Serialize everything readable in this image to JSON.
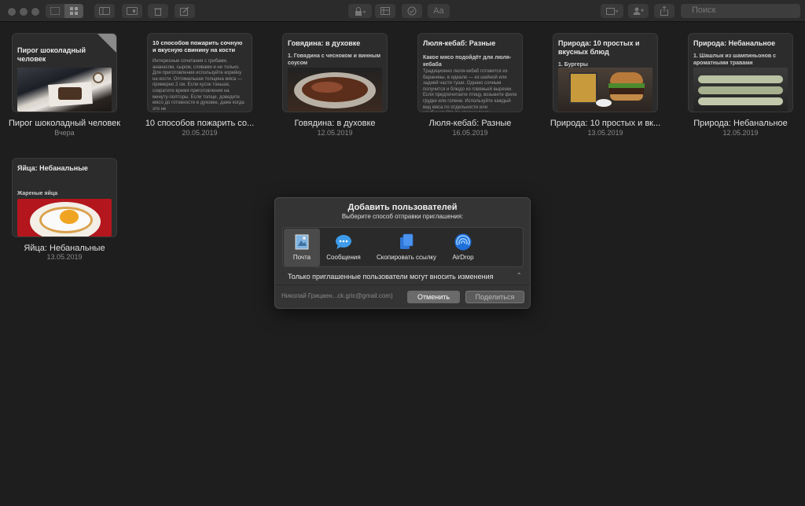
{
  "toolbar": {
    "search_placeholder": "Поиск",
    "font_button": "Aa"
  },
  "notes": [
    {
      "title": "Пирог шоколадный человек",
      "caption": "Пирог шоколадный человек",
      "date": "Вчера",
      "pinned": true,
      "image": "food-photo-cake"
    },
    {
      "title": "10 способов пожарить сочную и вкусную свинину на кости",
      "caption": "10 способов пожарить со...",
      "date": "20.05.2019",
      "body": "Интересные сочетания с грибами, ананасом, сыром, сливами и не только. Для приготовления используйте корейку на кости. Оптимальная толщина мяса — примерно 2 см. Если кусок тоньше, сократите время приготовления на минуту-полторы. Если толще, доведите мясо до готовности в духовке, даже когда это не"
    },
    {
      "title": "Говядина: в духовке",
      "subtitle": "1. Говядина с чесноком и винным соусом",
      "caption": "Говядина: в духовке",
      "date": "12.05.2019",
      "image": "food-photo-beef"
    },
    {
      "title": "Люля-кебаб: Разные",
      "subtitle": "Какое мясо подойдёт для люля-кебаба",
      "caption": "Люля-кебаб: Разные",
      "date": "16.05.2019",
      "body": "Традиционно люля-кебаб готовится из баранины, в идеале — из шейной или задней части туши. Однако сочным получится и блюдо из говяжьей вырезки. Если предпочитаете птицу, возьмите филе грудки или голени. Используйте каждый вид мяса по отдельности или комбинируйте по своему вкусу."
    },
    {
      "title": "Природа: 10 простых и вкусных блюд",
      "subtitle": "1. Бургеры",
      "caption": "Природа: 10 простых и вк...",
      "date": "13.05.2019",
      "image": "food-photo-burger"
    },
    {
      "title": "Природа: Небанальное",
      "subtitle": "1. Шашлык из шампиньонов с ароматными травами",
      "caption": "Природа: Небанальное",
      "date": "12.05.2019",
      "image": "food-photo-skewers"
    },
    {
      "title": "Яйца: Небанальные",
      "subtitle": "Жареные яйца",
      "caption": "Яйца: Небанальные",
      "date": "13.05.2019",
      "image": "food-photo-egg"
    }
  ],
  "dialog": {
    "title": "Добавить пользователей",
    "subtitle": "Выберите способ отправки приглашения:",
    "options": [
      {
        "label": "Почта",
        "icon": "mail-icon",
        "selected": true
      },
      {
        "label": "Сообщения",
        "icon": "messages-icon"
      },
      {
        "label": "Скопировать ссылку",
        "icon": "copy-link-icon"
      },
      {
        "label": "AirDrop",
        "icon": "airdrop-icon"
      }
    ],
    "permission": "Только приглашенные пользователи могут вносить изменения",
    "owner": "Николай Грицаен...ck.gric@gmail.com)",
    "cancel": "Отменить",
    "share": "Поделиться"
  }
}
